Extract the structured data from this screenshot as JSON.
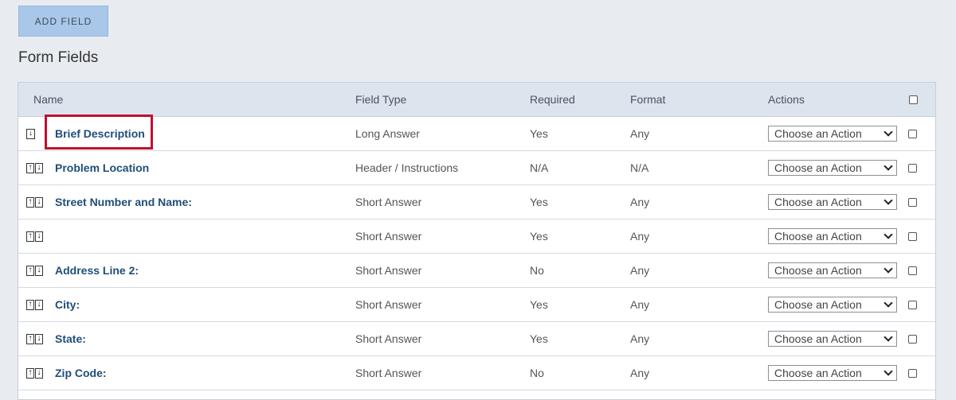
{
  "toolbar": {
    "add_field_label": "ADD FIELD"
  },
  "section": {
    "title": "Form Fields"
  },
  "table": {
    "columns": {
      "name": "Name",
      "type": "Field Type",
      "required": "Required",
      "format": "Format",
      "actions": "Actions"
    },
    "rows": [
      {
        "name": "Brief Description",
        "type": "Long Answer",
        "required": "Yes",
        "format": "Any",
        "action": "Choose an Action",
        "arrows": "down"
      },
      {
        "name": "Problem Location",
        "type": "Header / Instructions",
        "required": "N/A",
        "format": "N/A",
        "action": "Choose an Action",
        "arrows": "both"
      },
      {
        "name": "Street Number and Name:",
        "type": "Short Answer",
        "required": "Yes",
        "format": "Any",
        "action": "Choose an Action",
        "arrows": "both"
      },
      {
        "name": "",
        "type": "Short Answer",
        "required": "Yes",
        "format": "Any",
        "action": "Choose an Action",
        "arrows": "both"
      },
      {
        "name": "Address Line 2:",
        "type": "Short Answer",
        "required": "No",
        "format": "Any",
        "action": "Choose an Action",
        "arrows": "both"
      },
      {
        "name": "City:",
        "type": "Short Answer",
        "required": "Yes",
        "format": "Any",
        "action": "Choose an Action",
        "arrows": "both"
      },
      {
        "name": "State:",
        "type": "Short Answer",
        "required": "Yes",
        "format": "Any",
        "action": "Choose an Action",
        "arrows": "both"
      },
      {
        "name": "Zip Code:",
        "type": "Short Answer",
        "required": "No",
        "format": "Any",
        "action": "Choose an Action",
        "arrows": "both"
      }
    ]
  },
  "colors": {
    "highlight": "#c0102f",
    "link": "#1f4e79",
    "button_bg": "#a9c7e8",
    "header_bg": "#dce4ee"
  },
  "icons": {
    "move_up": "arrow-up-icon",
    "move_down": "arrow-down-icon",
    "dropdown": "chevron-down-icon"
  }
}
